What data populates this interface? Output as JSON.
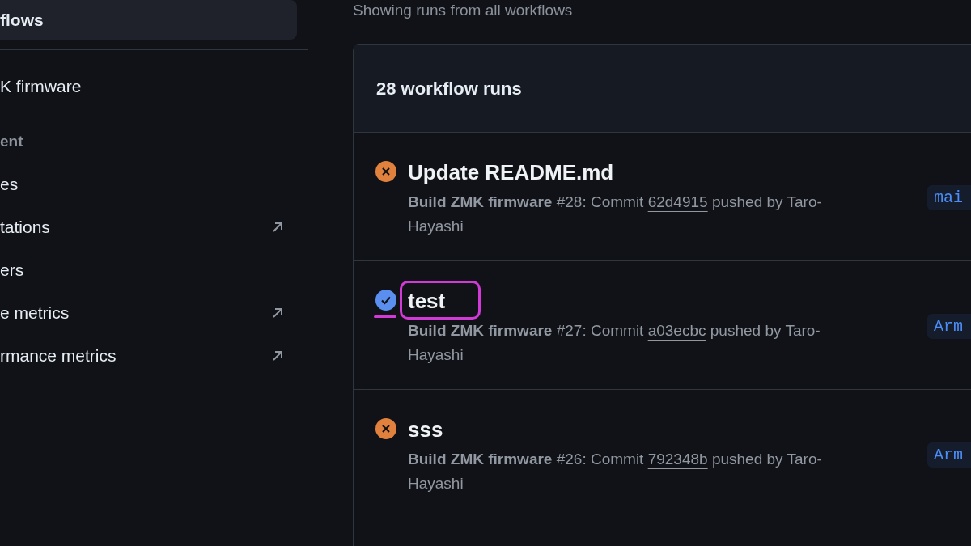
{
  "sidebar": {
    "items": [
      {
        "kind": "item",
        "label": "flows",
        "selected": true,
        "external": false
      },
      {
        "kind": "divider"
      },
      {
        "kind": "item",
        "label": "K firmware",
        "selected": false,
        "external": false
      },
      {
        "kind": "divider"
      },
      {
        "kind": "heading",
        "label": "ent"
      },
      {
        "kind": "item",
        "label": "es",
        "selected": false,
        "external": false
      },
      {
        "kind": "item",
        "label": "tations",
        "selected": false,
        "external": true
      },
      {
        "kind": "item",
        "label": "ers",
        "selected": false,
        "external": false
      },
      {
        "kind": "item",
        "label": "e metrics",
        "selected": false,
        "external": true
      },
      {
        "kind": "item",
        "label": "rmance metrics",
        "selected": false,
        "external": true
      }
    ]
  },
  "main": {
    "subtitle": "Showing runs from all workflows",
    "runs": {
      "count": "28 workflow runs",
      "rows": [
        {
          "kind": "failure",
          "title": "Update README.md",
          "workflow": "Build ZMK firmware",
          "number": "#28: Commit",
          "commit": "62d4915",
          "pushed": "pushed by Taro-Hayashi",
          "branch": "mai",
          "highlighted": false
        },
        {
          "kind": "success",
          "title": "test",
          "workflow": "Build ZMK firmware",
          "number": "#27: Commit",
          "commit": "a03ecbc",
          "pushed": "pushed by Taro-Hayashi",
          "branch": "Arm",
          "highlighted": true
        },
        {
          "kind": "failure",
          "title": "sss",
          "workflow": "Build ZMK firmware",
          "number": "#26: Commit",
          "commit": "792348b",
          "pushed": "pushed by Taro-Hayashi",
          "branch": "Arm",
          "highlighted": false
        }
      ]
    }
  }
}
